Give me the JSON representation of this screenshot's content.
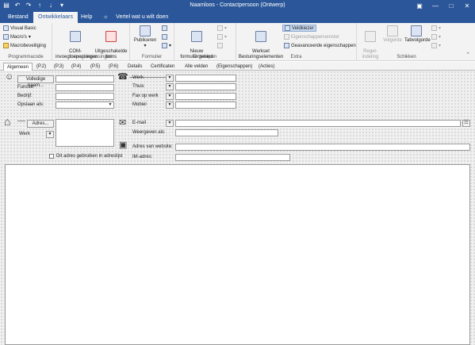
{
  "titlebar": {
    "title": "Naamloos  -  Contactpersoon  (Ontwerp)",
    "qat_icons": [
      "save-icon",
      "undo-icon",
      "redo-icon",
      "up-icon",
      "down-icon",
      "customize-icon"
    ],
    "window_buttons": [
      "ribbon-display-icon",
      "minimize-icon",
      "maximize-icon",
      "close-icon"
    ]
  },
  "tabs": {
    "bestand": "Bestand",
    "ontwikkelaars": "Ontwikkelaars",
    "help": "Help",
    "tellme": "Vertel wat u wilt doen"
  },
  "ribbon": {
    "programmacode": {
      "label": "Programmacode",
      "visual_basic": "Visual Basic",
      "macros": "Macro's",
      "macrobeveiliging": "Macrobeveiliging"
    },
    "invoegtoepassingen": {
      "label": "Invoegtoepassingen",
      "com": "COM-\ninvoegtoepassingen",
      "uitgeschakelde": "Uitgeschakelde\nitems"
    },
    "formulier": {
      "label": "Formulier",
      "publiceren": "Publiceren"
    },
    "ontwerpen": {
      "label": "Ontwerpen",
      "nieuw": "Nieuw\nformuliergebied"
    },
    "extra": {
      "label": "Extra",
      "werkset": "Werkset\nBesturingselementen",
      "veldkiezer": "Veldkiezer",
      "eigenschappenvenster": "Eigenschappenvenster",
      "geavanceerde": "Geavanceerde eigenschappen"
    },
    "schikken": {
      "label": "Schikken",
      "regelindeling": "Regel-\nindeling",
      "volgorde": "Volgorde",
      "tabvolgorde": "Tabvolgorde"
    }
  },
  "formtabs": [
    "Algemeen",
    "(P.2)",
    "(P.3)",
    "(P.4)",
    "(P.5)",
    "(P.6)",
    "Details",
    "Certificaten",
    "Alle velden",
    "(Eigenschappen)",
    "(Acties)"
  ],
  "form": {
    "volledige_naam": "Volledige naam...",
    "functie": "Functie:",
    "bedrijf": "Bedrijf:",
    "opslaan_als": "Opslaan als:",
    "adres": "Adres...",
    "werk_adres": "Werk",
    "adres_checkbox": "Dit adres gebruiken in adreslijst",
    "phones": [
      "Werk",
      "Thuis",
      "Fax op werk",
      "Mobiel"
    ],
    "email": "E-mail",
    "weergeven_als": "Weergeven als:",
    "website": "Adres van website:",
    "im_adres": "IM-adres:"
  }
}
